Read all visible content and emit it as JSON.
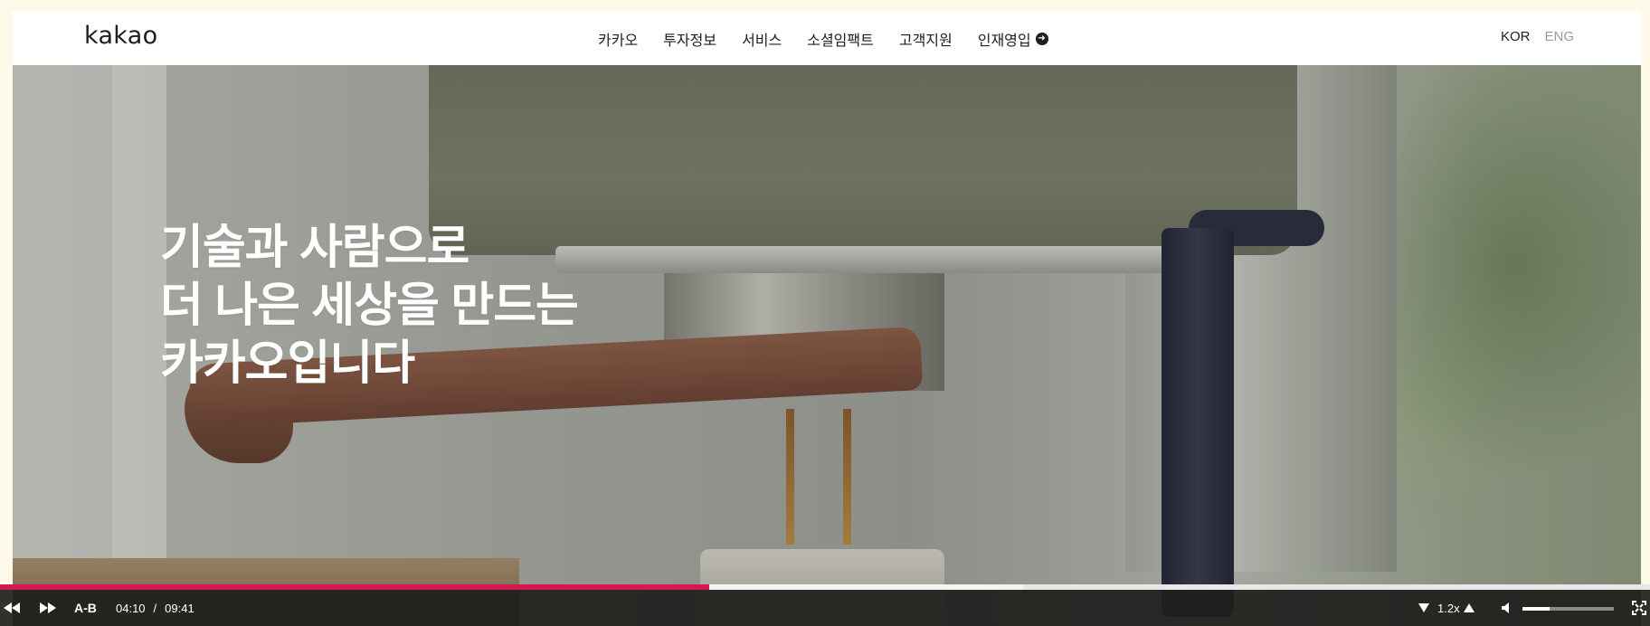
{
  "header": {
    "logo": "kakao",
    "nav": [
      {
        "label": "카카오"
      },
      {
        "label": "투자정보"
      },
      {
        "label": "서비스"
      },
      {
        "label": "소셜임팩트"
      },
      {
        "label": "고객지원"
      },
      {
        "label": "인재영입",
        "icon": "arrow-right-circle-icon"
      }
    ],
    "languages": {
      "active": "KOR",
      "inactive": "ENG"
    }
  },
  "hero": {
    "title_lines": [
      "기술과 사람으로",
      "더 나은 세상을 만드는",
      "카카오입니다"
    ]
  },
  "video_player": {
    "ab_label": "A-B",
    "current_time": "04:10",
    "separator": "/",
    "duration": "09:41",
    "progress_fraction": 0.43,
    "buffered_fraction": 0.62,
    "speed": "1.2x",
    "volume_fraction": 0.3,
    "accent_color": "#d3194f",
    "icons": [
      "rewind-icon",
      "fast-forward-icon",
      "speed-down-icon",
      "speed-up-icon",
      "volume-icon",
      "fullscreen-icon"
    ]
  }
}
